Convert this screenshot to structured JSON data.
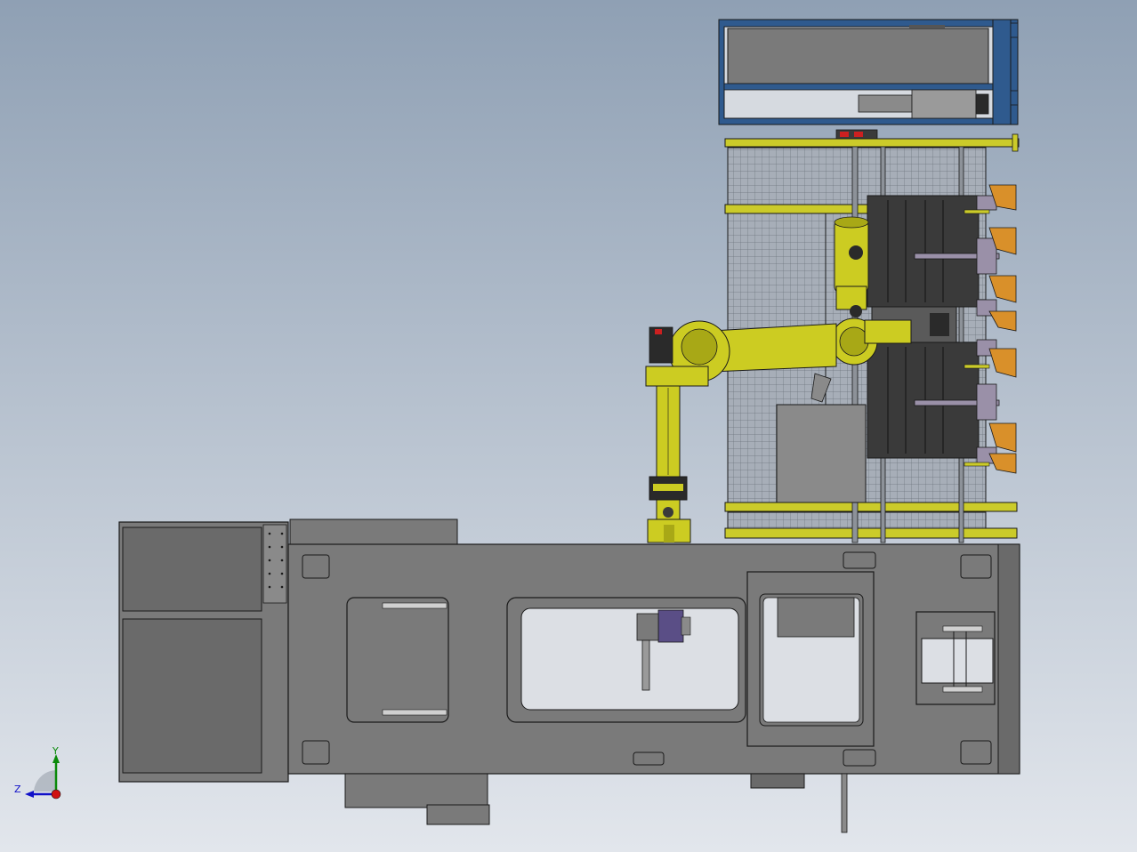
{
  "viewport": {
    "background_top": "#8fa0b4",
    "background_bottom": "#e2e6ec"
  },
  "colors": {
    "machine_gray": "#7a7a7a",
    "machine_dark": "#6a6a6a",
    "outline": "#1a1a1a",
    "robot_yellow": "#cccc22",
    "robot_yellow_dark": "#a8a816",
    "fence_yellow": "#cbcb2a",
    "fence_mesh_bg": "#a7aeb8",
    "fence_mesh_line": "#6c737c",
    "frame_blue": "#2f5a8e",
    "orange": "#d9902a",
    "arm_lavender": "#9a90a8",
    "purple_part": "#5a4e86",
    "red": "#cc2020",
    "triad_x": "#d01010",
    "triad_y": "#0a8a0a",
    "triad_z": "#1010c8"
  },
  "triad": {
    "y_label": "Y",
    "z_label": "Z"
  }
}
